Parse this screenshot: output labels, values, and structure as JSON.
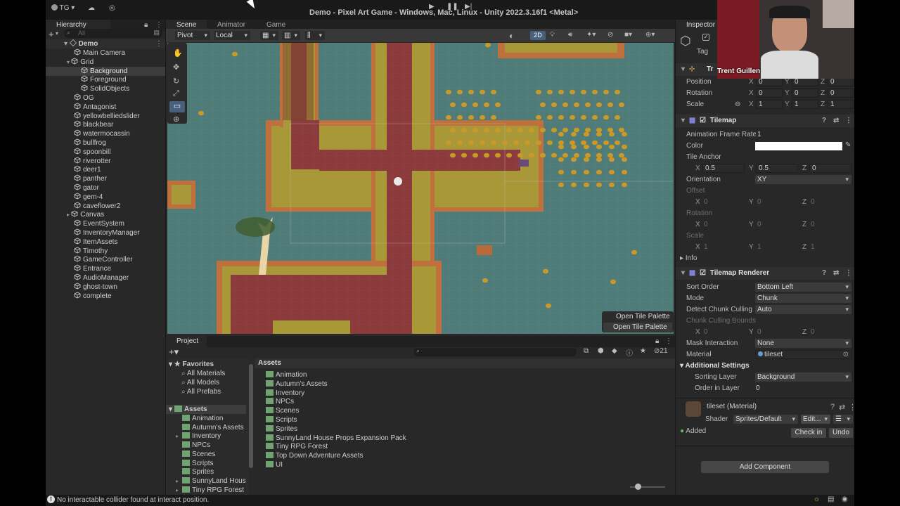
{
  "window": {
    "title": "Demo - Pixel Art Game - Windows, Mac, Linux - Unity 2022.3.16f1 <Metal>",
    "account": "TG"
  },
  "hierarchy": {
    "tab": "Hierarchy",
    "search_placeholder": "All",
    "root": "Demo",
    "items": [
      {
        "label": "Main Camera",
        "indent": 1
      },
      {
        "label": "Grid",
        "indent": 1
      },
      {
        "label": "Background",
        "indent": 2,
        "selected": true
      },
      {
        "label": "Foreground",
        "indent": 2
      },
      {
        "label": "SolidObjects",
        "indent": 2
      },
      {
        "label": "OG",
        "indent": 1
      },
      {
        "label": "Antagonist",
        "indent": 1
      },
      {
        "label": "yellowbelliedslider",
        "indent": 1
      },
      {
        "label": "blackbear",
        "indent": 1
      },
      {
        "label": "watermocassin",
        "indent": 1
      },
      {
        "label": "bullfrog",
        "indent": 1
      },
      {
        "label": "spoonbill",
        "indent": 1
      },
      {
        "label": "riverotter",
        "indent": 1
      },
      {
        "label": "deer1",
        "indent": 1
      },
      {
        "label": "panther",
        "indent": 1
      },
      {
        "label": "gator",
        "indent": 1
      },
      {
        "label": "gem-4",
        "indent": 1
      },
      {
        "label": "caveflower2",
        "indent": 1
      },
      {
        "label": "Canvas",
        "indent": 1
      },
      {
        "label": "EventSystem",
        "indent": 1
      },
      {
        "label": "InventoryManager",
        "indent": 1
      },
      {
        "label": "ItemAssets",
        "indent": 1
      },
      {
        "label": "Timothy",
        "indent": 1
      },
      {
        "label": "GameController",
        "indent": 1
      },
      {
        "label": "Entrance",
        "indent": 1
      },
      {
        "label": "AudioManager",
        "indent": 1
      },
      {
        "label": "ghost-town",
        "indent": 1
      },
      {
        "label": "complete",
        "indent": 1
      }
    ]
  },
  "scene": {
    "tabs": [
      "Scene",
      "Animator",
      "Game"
    ],
    "pivot": "Pivot",
    "local": "Local",
    "mode_2d": "2D",
    "overlay_title": "Open Tile Palette",
    "overlay_button": "Open Tile Palette"
  },
  "project": {
    "tab": "Project",
    "favorites_label": "Favorites",
    "favorites": [
      "All Materials",
      "All Models",
      "All Prefabs"
    ],
    "assets_label": "Assets",
    "tree": [
      "Animation",
      "Autumn's Assets",
      "Inventory",
      "NPCs",
      "Scenes",
      "Scripts",
      "Sprites",
      "SunnyLand House",
      "Tiny RPG Forest"
    ],
    "breadcrumb": "Assets",
    "folders": [
      "Animation",
      "Autumn's Assets",
      "Inventory",
      "NPCs",
      "Scenes",
      "Scripts",
      "Sprites",
      "SunnyLand House Props Expansion Pack",
      "Tiny RPG Forest",
      "Top Down Adventure Assets",
      "UI"
    ],
    "hidden_count": "21"
  },
  "inspector": {
    "tab": "Inspector",
    "tag_label": "Tag",
    "transform_label": "Tr",
    "position": {
      "label": "Position",
      "x": "0",
      "y": "0",
      "z": "0"
    },
    "rotation": {
      "label": "Rotation",
      "x": "0",
      "y": "0",
      "z": "0"
    },
    "scale": {
      "label": "Scale",
      "x": "1",
      "y": "1",
      "z": "1"
    },
    "tilemap": {
      "title": "Tilemap",
      "anim_rate_label": "Animation Frame Rate",
      "anim_rate": "1",
      "color_label": "Color",
      "color_value": "#ffffff",
      "anchor_label": "Tile Anchor",
      "anchor_x": "0.5",
      "anchor_y": "0.5",
      "anchor_z": "0",
      "orientation_label": "Orientation",
      "orientation": "XY",
      "offset_label": "Offset",
      "offset": [
        "0",
        "0",
        "0"
      ],
      "rotation_label": "Rotation",
      "rotation": [
        "0",
        "0",
        "0"
      ],
      "scale_label": "Scale",
      "scale": [
        "1",
        "1",
        "1"
      ],
      "info_label": "Info"
    },
    "renderer": {
      "title": "Tilemap Renderer",
      "sort_order_label": "Sort Order",
      "sort_order": "Bottom Left",
      "mode_label": "Mode",
      "mode": "Chunk",
      "detect_label": "Detect Chunk Culling",
      "detect": "Auto",
      "bounds_label": "Chunk Culling Bounds",
      "bounds": [
        "0",
        "0",
        "0"
      ],
      "mask_label": "Mask Interaction",
      "mask": "None",
      "material_label": "Material",
      "material": "tileset",
      "additional_label": "Additional Settings",
      "sorting_layer_label": "Sorting Layer",
      "sorting_layer": "Background",
      "order_label": "Order in Layer",
      "order": "0"
    },
    "material": {
      "title": "tileset (Material)",
      "shader_label": "Shader",
      "shader": "Sprites/Default",
      "edit": "Edit...",
      "added": "Added",
      "check_in": "Check in",
      "undo": "Undo"
    },
    "add_component": "Add Component"
  },
  "webcam": {
    "name": "Trent Guillen"
  },
  "status": {
    "message": "No interactable collider found at interact position."
  },
  "colors": {
    "water": "#4f7c78",
    "path": "#8a3a3a",
    "grass": "#a69a3a",
    "border": "#c0703c"
  }
}
